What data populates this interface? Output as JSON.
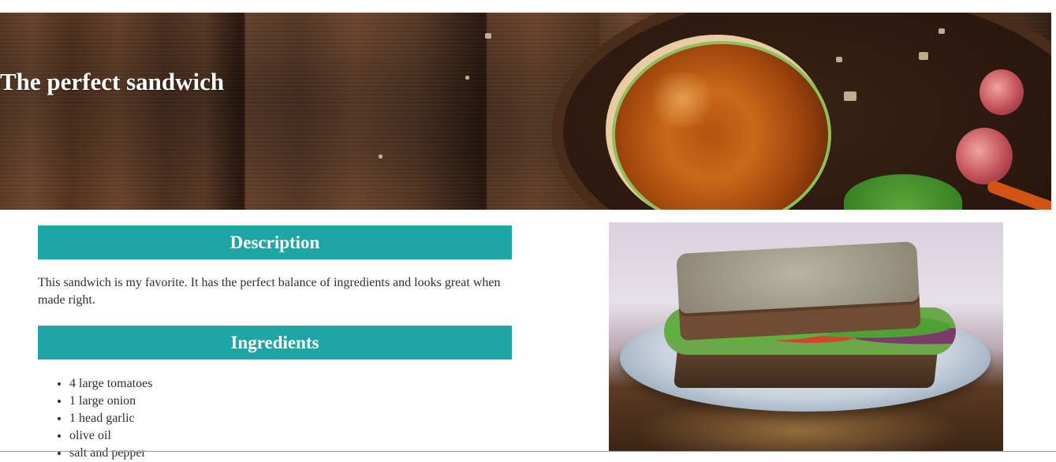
{
  "hero": {
    "title": "The perfect sandwich"
  },
  "description": {
    "heading": "Description",
    "text": "This sandwich is my favorite. It has the perfect balance of ingredients and looks great when made right."
  },
  "ingredients": {
    "heading": "Ingredients",
    "items": [
      "4 large tomatoes",
      "1 large onion",
      "1 head garlic",
      "olive oil",
      "salt and pepper"
    ]
  },
  "colors": {
    "section_bar": "#1ea6a7",
    "title_text": "#ffffff",
    "body_text": "#2f2f2f"
  }
}
